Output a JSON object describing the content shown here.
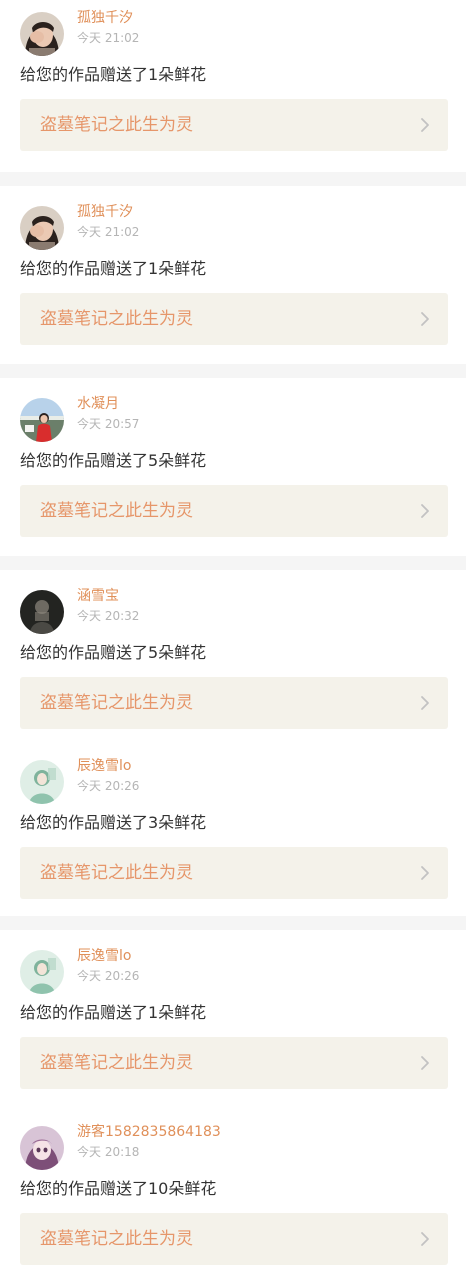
{
  "colors": {
    "page_background": "#f5f5f5",
    "card_background": "#ffffff",
    "username": "#e0905a",
    "time": "#b5b5b5",
    "message": "#333333",
    "work_link_background": "#f4f2ea",
    "work_title": "#e6966a",
    "chevron": "#c2c2c2"
  },
  "notifications": [
    {
      "avatar_icon": "avatar-girl-covering-eye",
      "username": "孤独千汐",
      "time": "今天 21:02",
      "message": "给您的作品赠送了1朵鲜花",
      "work_title": "盗墓笔记之此生为灵",
      "chevron_icon": "chevron-right-icon"
    },
    {
      "avatar_icon": "avatar-girl-covering-eye",
      "username": "孤独千汐",
      "time": "今天 21:02",
      "message": "给您的作品赠送了1朵鲜花",
      "work_title": "盗墓笔记之此生为灵",
      "chevron_icon": "chevron-right-icon"
    },
    {
      "avatar_icon": "avatar-girl-red-dress-outdoor",
      "username": "水凝月",
      "time": "今天 20:57",
      "message": "给您的作品赠送了5朵鲜花",
      "work_title": "盗墓笔记之此生为灵",
      "chevron_icon": "chevron-right-icon"
    },
    {
      "avatar_icon": "avatar-dark-portrait",
      "username": "涵雪宝",
      "time": "今天 20:32",
      "message": "给您的作品赠送了5朵鲜花",
      "work_title": "盗墓笔记之此生为灵",
      "chevron_icon": "chevron-right-icon"
    },
    {
      "avatar_icon": "avatar-girl-green-illustration",
      "username": "辰逸雪lo",
      "time": "今天 20:26",
      "message": "给您的作品赠送了3朵鲜花",
      "work_title": "盗墓笔记之此生为灵",
      "chevron_icon": "chevron-right-icon"
    },
    {
      "avatar_icon": "avatar-girl-green-illustration",
      "username": "辰逸雪lo",
      "time": "今天 20:26",
      "message": "给您的作品赠送了1朵鲜花",
      "work_title": "盗墓笔记之此生为灵",
      "chevron_icon": "chevron-right-icon"
    },
    {
      "avatar_icon": "avatar-anime-girl-purple",
      "username": "游客1582835864183",
      "time": "今天 20:18",
      "message": "给您的作品赠送了10朵鲜花",
      "work_title": "盗墓笔记之此生为灵",
      "chevron_icon": "chevron-right-icon"
    }
  ]
}
